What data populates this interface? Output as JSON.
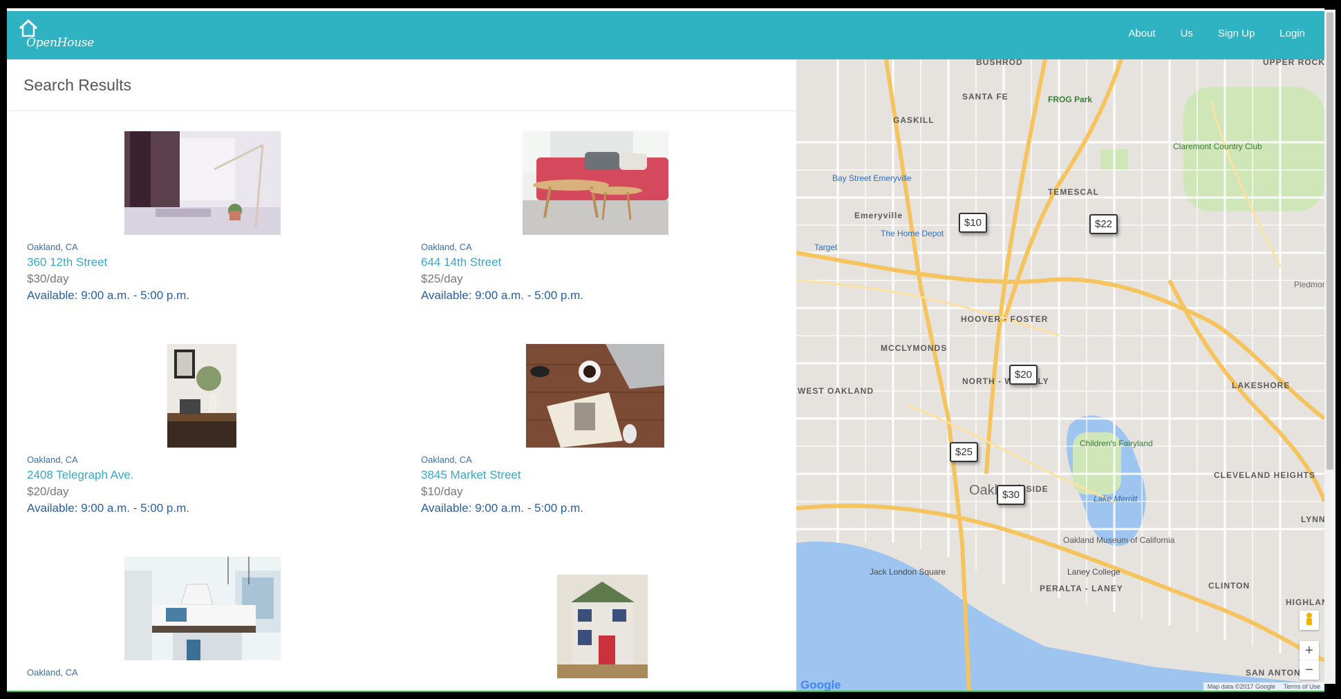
{
  "brand": {
    "name": "OpenHouse"
  },
  "nav": [
    {
      "label": "About"
    },
    {
      "label": "Us"
    },
    {
      "label": "Sign Up"
    },
    {
      "label": "Login"
    }
  ],
  "results": {
    "title": "Search Results",
    "listings": [
      {
        "city": "Oakland, CA",
        "address": "360 12th Street",
        "price": "$30/day",
        "available": "Available: 9:00 a.m. - 5:00 p.m.",
        "photo": "desk-lamp-photo"
      },
      {
        "city": "Oakland, CA",
        "address": "644 14th Street",
        "price": "$25/day",
        "available": "Available: 9:00 a.m. - 5:00 p.m.",
        "photo": "pink-sofa-photo"
      },
      {
        "city": "Oakland, CA",
        "address": "2408 Telegraph Ave.",
        "price": "$20/day",
        "available": "Available: 9:00 a.m. - 5:00 p.m.",
        "photo": "home-office-photo"
      },
      {
        "city": "Oakland, CA",
        "address": "3845 Market Street",
        "price": "$10/day",
        "available": "Available: 9:00 a.m. - 5:00 p.m.",
        "photo": "laptop-coffee-photo"
      },
      {
        "city": "Oakland, CA",
        "address": "",
        "price": "",
        "available": "",
        "photo": "kitchen-photo"
      },
      {
        "city": "",
        "address": "",
        "price": "",
        "available": "",
        "photo": "toy-house-photo"
      }
    ]
  },
  "map": {
    "pins": [
      {
        "label": "$10"
      },
      {
        "label": "$22"
      },
      {
        "label": "$20"
      },
      {
        "label": "$25"
      },
      {
        "label": "$30"
      }
    ],
    "places": [
      "BUSHROD",
      "SANTA FE",
      "GASKILL",
      "FROG Park",
      "Claremont Country Club",
      "UPPER ROCKRIDGE",
      "Bay Street Emeryville",
      "Emeryville",
      "TEMESCAL",
      "Target",
      "The Home Depot",
      "HOOVER - FOSTER",
      "MCCLYMONDS",
      "NORTH - WAVERLY",
      "WEST OAKLAND",
      "LAKESHORE",
      "Children's Fairyland",
      "CLEVELAND HEIGHTS",
      "LAKESIDE",
      "Oakland Museum of California",
      "Jack London Square",
      "Laney College",
      "PERALTA - LANEY",
      "CLINTON",
      "HIGHLAND TERRACE",
      "SAN ANTONIO",
      "Lake Merritt",
      "Oakland",
      "Piedmont",
      "LYNN"
    ],
    "footer_data": "Map data ©2017 Google",
    "footer_terms": "Terms of Use",
    "zoom_in": "+",
    "zoom_out": "−",
    "logo": "Google"
  }
}
